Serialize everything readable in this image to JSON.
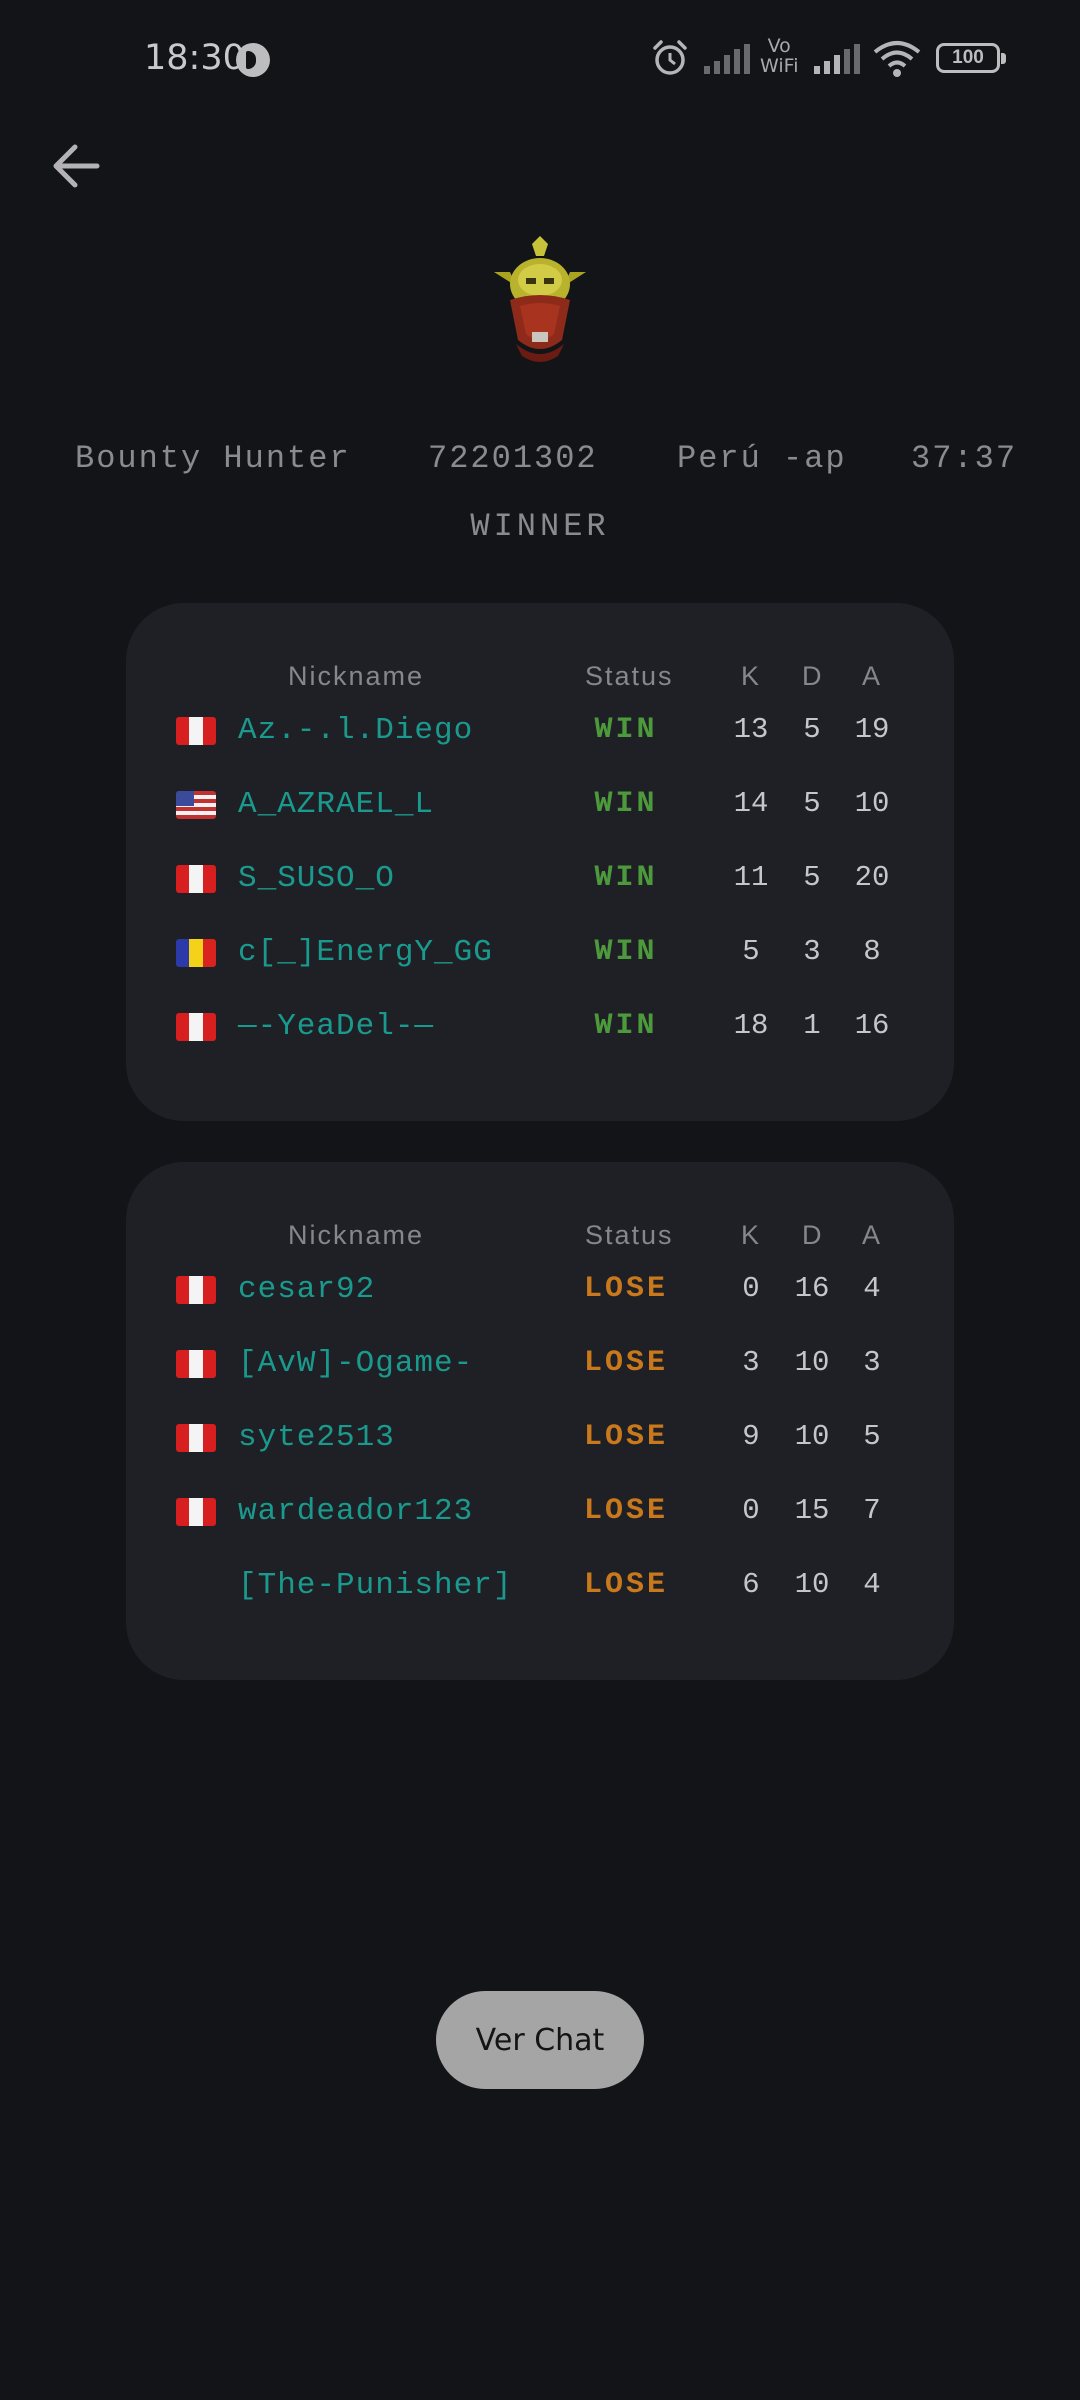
{
  "status_bar": {
    "time": "18:30",
    "vo_wifi_line1": "Vo",
    "vo_wifi_line2": "WiFi",
    "battery": "100",
    "icons": [
      "app-notification-icon",
      "alarm-icon",
      "signal-icon",
      "vowifi-icon",
      "signal-icon",
      "wifi-icon",
      "battery-icon"
    ]
  },
  "nav": {
    "back_icon": "arrow-left-icon"
  },
  "match": {
    "hero": "Bounty Hunter",
    "match_id": "72201302",
    "server": "Perú -ap",
    "duration": "37:37",
    "result": "WINNER",
    "hero_icon": "bounty-hunter-hero-icon"
  },
  "columns": {
    "nickname": "Nickname",
    "status": "Status",
    "k": "K",
    "d": "D",
    "a": "A"
  },
  "teams": [
    {
      "rows": [
        {
          "flag": "peru",
          "nickname": "Az.-.l.Diego",
          "status": "WIN",
          "k": "13",
          "d": "5",
          "a": "19"
        },
        {
          "flag": "usa",
          "nickname": "A_AZRAEL_L",
          "status": "WIN",
          "k": "14",
          "d": "5",
          "a": "10"
        },
        {
          "flag": "peru",
          "nickname": "S_SUSO_O",
          "status": "WIN",
          "k": "11",
          "d": "5",
          "a": "20"
        },
        {
          "flag": "romania",
          "nickname": "c[_]EnergY_GG",
          "status": "WIN",
          "k": "5",
          "d": "3",
          "a": "8"
        },
        {
          "flag": "peru",
          "nickname": "—-YeaDel-—",
          "status": "WIN",
          "k": "18",
          "d": "1",
          "a": "16"
        }
      ]
    },
    {
      "rows": [
        {
          "flag": "peru",
          "nickname": "cesar92",
          "status": "LOSE",
          "k": "0",
          "d": "16",
          "a": "4"
        },
        {
          "flag": "peru",
          "nickname": "[AvW]-Ogame-",
          "status": "LOSE",
          "k": "3",
          "d": "10",
          "a": "3"
        },
        {
          "flag": "peru",
          "nickname": "syte2513",
          "status": "LOSE",
          "k": "9",
          "d": "10",
          "a": "5"
        },
        {
          "flag": "peru",
          "nickname": "wardeador123",
          "status": "LOSE",
          "k": "0",
          "d": "15",
          "a": "7"
        },
        {
          "flag": "none",
          "nickname": "[The-Punisher]",
          "status": "LOSE",
          "k": "6",
          "d": "10",
          "a": "4"
        }
      ]
    }
  ],
  "chat_button": {
    "label": "Ver Chat"
  },
  "colors": {
    "background": "#131418",
    "card": "#1f2025",
    "nickname": "#1a9a8e",
    "win": "#4c9a3c",
    "lose": "#c9791c"
  }
}
